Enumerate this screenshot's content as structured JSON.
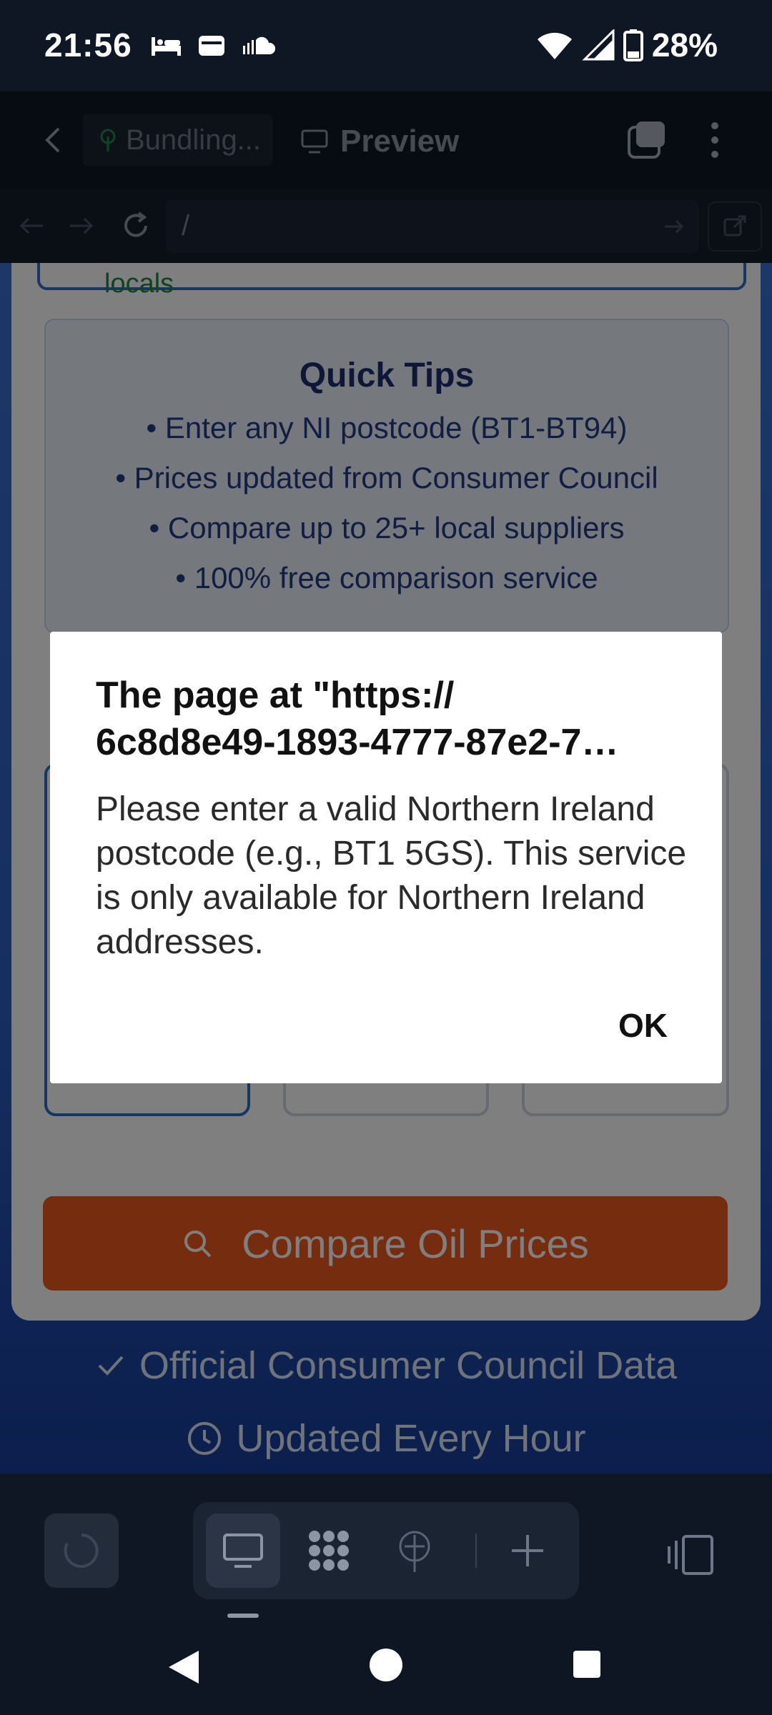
{
  "status_bar": {
    "time": "21:56",
    "battery": "28%"
  },
  "toolbar": {
    "project_name": "Bundling...",
    "preview_label": "Preview"
  },
  "url_bar": {
    "value": "/"
  },
  "page": {
    "locals_text": "locals",
    "tips": {
      "title": "Quick Tips",
      "items": [
        "• Enter any NI postcode (BT1-BT94)",
        "• Prices updated from Consumer Council",
        "• Compare up to 25+ local suppliers",
        "• 100% free comparison service"
      ]
    },
    "compare_button": "Compare Oil Prices",
    "trust": {
      "official": "Official Consumer Council Data",
      "updated": "Updated Every Hour"
    }
  },
  "dialog": {
    "title_line1": "The page at \"https://",
    "title_line2": "6c8d8e49-1893-4777-87e2-7…",
    "message": "Please enter a valid Northern Ireland postcode (e.g., BT1 5GS). This service is only available for Northern Ireland addresses.",
    "ok_label": "OK"
  },
  "colors": {
    "brand_orange": "#ec5a1f",
    "brand_blue": "#2e6fc6",
    "page_gradient": "#2d5ec2",
    "app_chrome": "#0f1725"
  }
}
